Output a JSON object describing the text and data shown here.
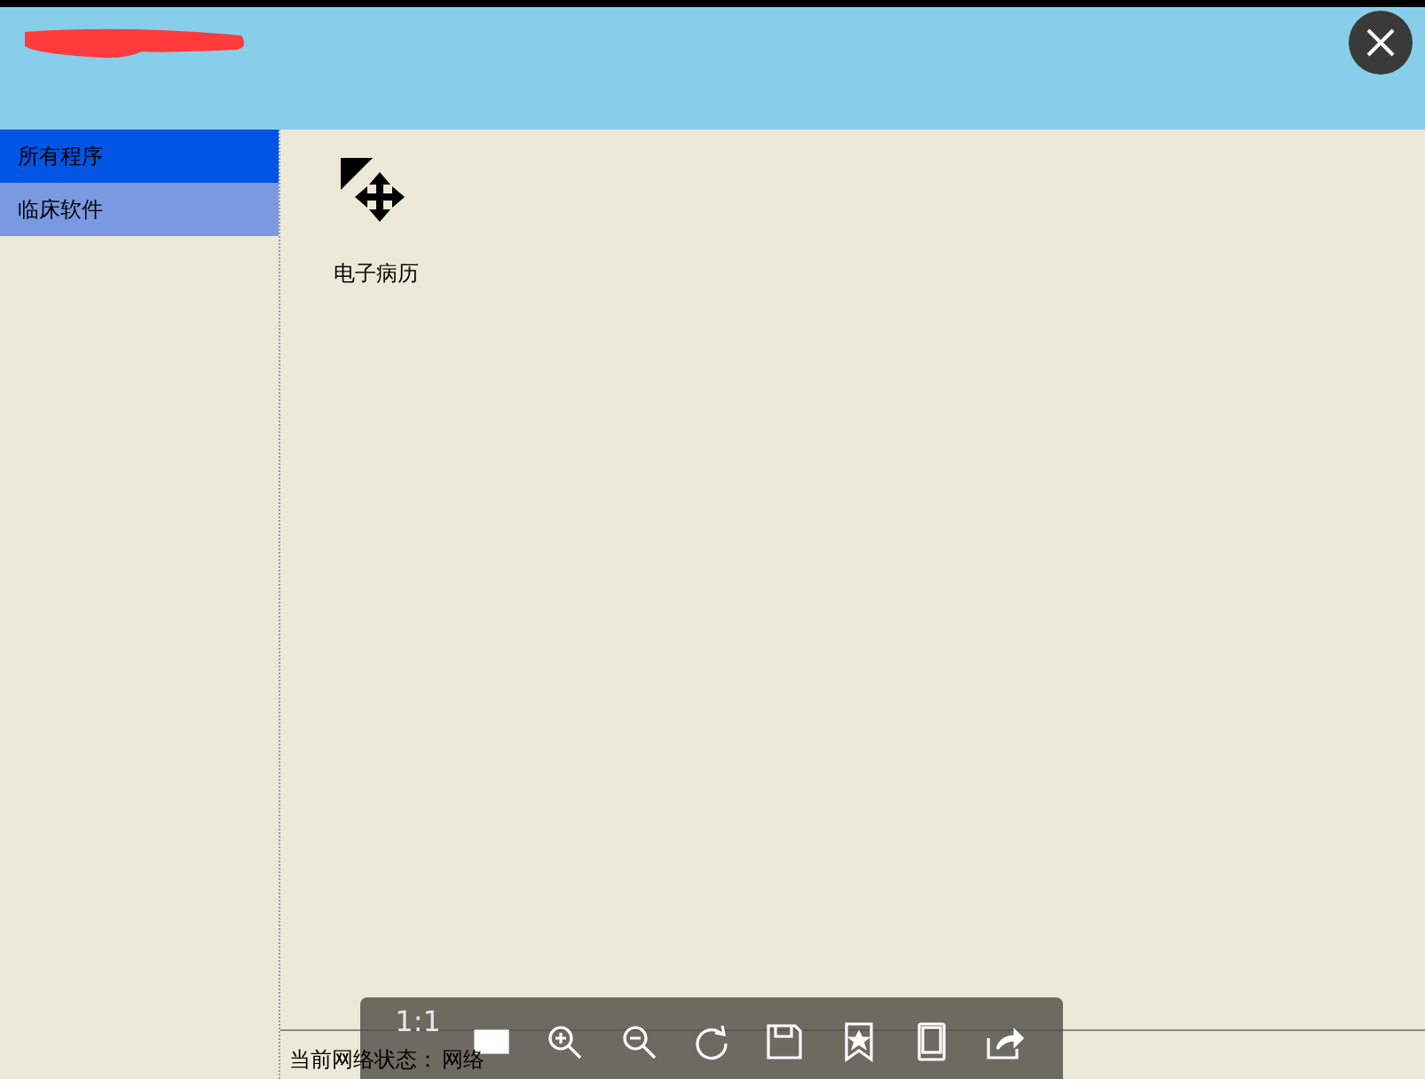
{
  "sidebar": {
    "items": [
      {
        "label": "所有程序",
        "selected": true
      },
      {
        "label": "临床软件",
        "selected": false
      }
    ]
  },
  "apps": [
    {
      "label": "电子病历"
    }
  ],
  "status_bar": {
    "label": "当前网络状态：",
    "value": "网络"
  },
  "viewer_toolbar": {
    "zoom_label": "1:1"
  }
}
